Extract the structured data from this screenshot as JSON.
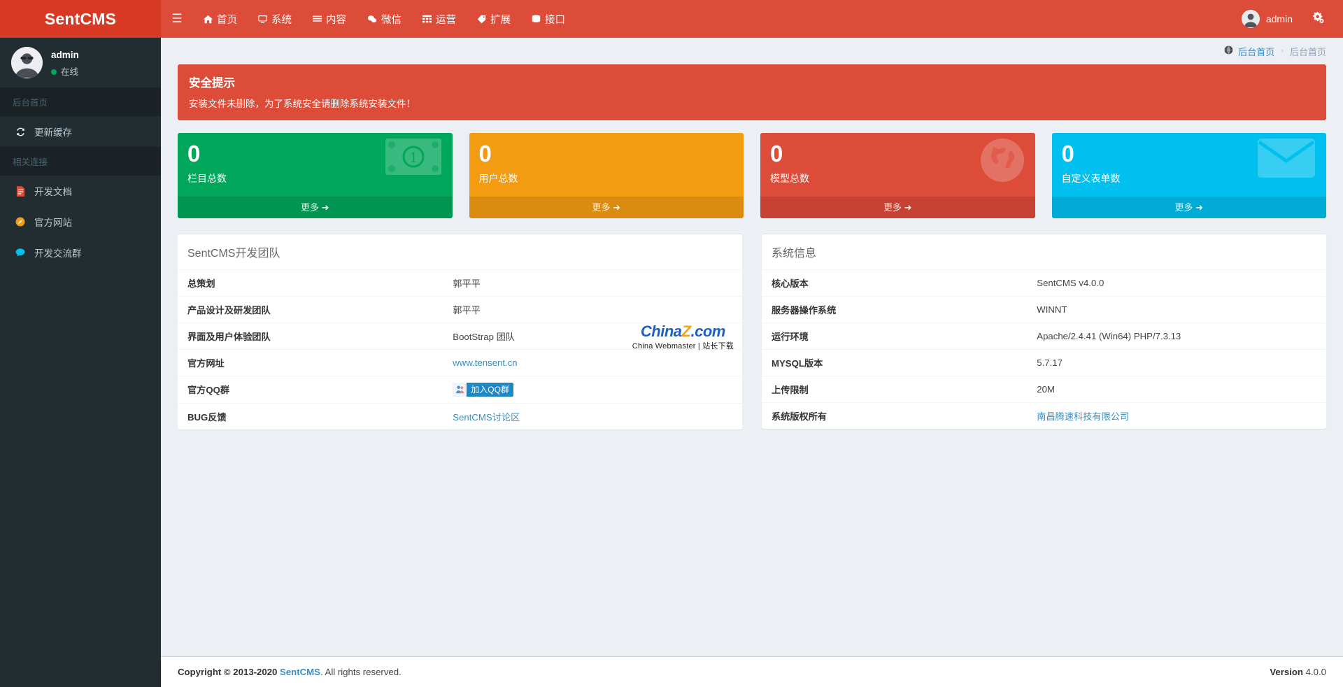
{
  "brand": {
    "title": "SentCMS"
  },
  "topnav": {
    "menu_icon": "hamburger-icon",
    "items": [
      {
        "label": "首页",
        "icon": "home-icon"
      },
      {
        "label": "系统",
        "icon": "desktop-icon"
      },
      {
        "label": "内容",
        "icon": "list-icon"
      },
      {
        "label": "微信",
        "icon": "wechat-icon"
      },
      {
        "label": "运营",
        "icon": "grid-icon"
      },
      {
        "label": "扩展",
        "icon": "tag-icon"
      },
      {
        "label": "接口",
        "icon": "database-icon"
      }
    ],
    "user": {
      "name": "admin",
      "avatar": "user-avatar"
    },
    "settings_icon": "gears-icon"
  },
  "sidebar": {
    "user": {
      "name": "admin",
      "status": "在线",
      "status_color": "#00a65a"
    },
    "sections": [
      {
        "header": "后台首页",
        "items": [
          {
            "label": "更新缓存",
            "icon": "refresh-icon",
            "color": "#ffffff"
          }
        ]
      },
      {
        "header": "相关连接",
        "items": [
          {
            "label": "开发文档",
            "icon": "file-text-icon",
            "color": "#dd4b39"
          },
          {
            "label": "官方网站",
            "icon": "compass-icon",
            "color": "#f39c12"
          },
          {
            "label": "开发交流群",
            "icon": "comment-icon",
            "color": "#00c0ef"
          }
        ]
      }
    ]
  },
  "breadcrumb": {
    "icon": "globe-icon",
    "root": "后台首页",
    "separator": "›",
    "current": "后台首页"
  },
  "alert": {
    "title": "安全提示",
    "text": "安装文件未删除，为了系统安全请删除系统安装文件！",
    "color": "#dd4b39"
  },
  "cards": [
    {
      "number": "0",
      "label": "栏目总数",
      "more": "更多",
      "color": "#00a65a",
      "icon": "money-icon"
    },
    {
      "number": "0",
      "label": "用户总数",
      "more": "更多",
      "color": "#f39c12",
      "icon": "none-icon"
    },
    {
      "number": "0",
      "label": "模型总数",
      "more": "更多",
      "color": "#dd4b39",
      "icon": "globe-icon"
    },
    {
      "number": "0",
      "label": "自定义表单数",
      "more": "更多",
      "color": "#00c0ef",
      "icon": "envelope-icon"
    }
  ],
  "team_panel": {
    "title": "SentCMS开发团队",
    "rows": [
      {
        "key": "总策划",
        "value": "郭平平",
        "type": "text"
      },
      {
        "key": "产品设计及研发团队",
        "value": "郭平平",
        "type": "text"
      },
      {
        "key": "界面及用户体验团队",
        "value": "BootStrap 团队",
        "type": "text"
      },
      {
        "key": "官方网址",
        "value": "www.tensent.cn",
        "type": "link"
      },
      {
        "key": "官方QQ群",
        "value": "加入QQ群",
        "type": "badge"
      },
      {
        "key": "BUG反馈",
        "value": "SentCMS讨论区",
        "type": "link"
      }
    ]
  },
  "system_panel": {
    "title": "系统信息",
    "rows": [
      {
        "key": "核心版本",
        "value": "SentCMS v4.0.0",
        "type": "text"
      },
      {
        "key": "服务器操作系统",
        "value": "WINNT",
        "type": "text"
      },
      {
        "key": "运行环境",
        "value": "Apache/2.4.41 (Win64) PHP/7.3.13",
        "type": "text"
      },
      {
        "key": "MYSQL版本",
        "value": "5.7.17",
        "type": "text"
      },
      {
        "key": "上传限制",
        "value": "20M",
        "type": "text"
      },
      {
        "key": "系统版权所有",
        "value": "南昌腾速科技有限公司",
        "type": "link"
      }
    ]
  },
  "watermark": {
    "line1_a": "China",
    "line1_z": "Z",
    "line1_b": ".com",
    "line2": "China Webmaster | 站长下载"
  },
  "footer": {
    "copyright_pre": "Copyright © 2013-2020 ",
    "copyright_link": "SentCMS",
    "copyright_post": ". All rights reserved.",
    "version_label": "Version",
    "version_value": "4.0.0"
  }
}
